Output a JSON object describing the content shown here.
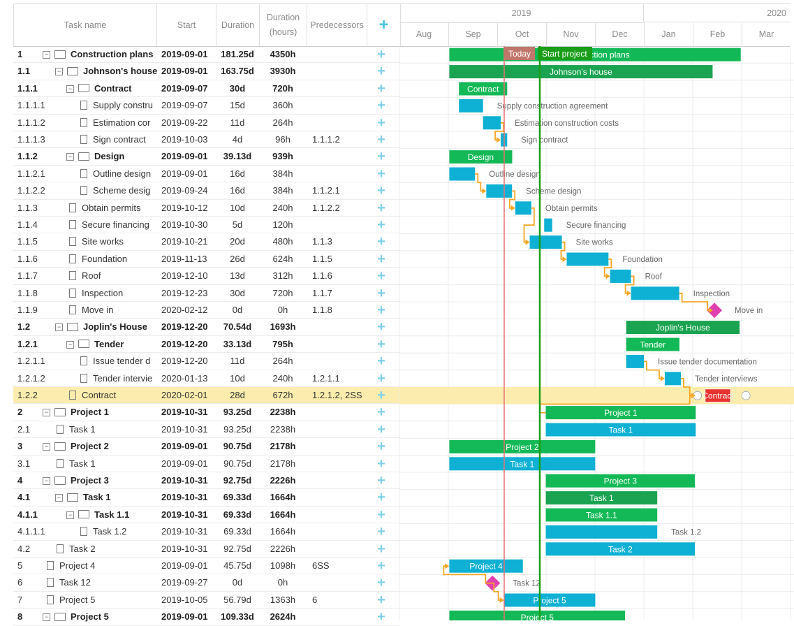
{
  "columns": {
    "task_name": "Task name",
    "start": "Start",
    "duration": "Duration",
    "duration_hours_1": "Duration",
    "duration_hours_2": "(hours)",
    "predecessors": "Predecessors",
    "add": "+"
  },
  "timeline": {
    "years": [
      {
        "label": "2019"
      },
      {
        "label": "2020"
      }
    ],
    "months": [
      "Aug",
      "Sep",
      "Oct",
      "Nov",
      "Dec",
      "Jan",
      "Feb",
      "Mar"
    ],
    "today_label": "Today",
    "start_label": "Start project"
  },
  "tasks": [
    {
      "wbs": "1",
      "name": "Construction plans",
      "start": "2019-09-01",
      "duration": "181.25d",
      "hours": "4350h",
      "pred": "",
      "bold": true,
      "level": 0,
      "icon": "folder",
      "bar": "Construction plans"
    },
    {
      "wbs": "1.1",
      "name": "Johnson's house",
      "start": "2019-09-01",
      "duration": "163.75d",
      "hours": "3930h",
      "pred": "",
      "bold": true,
      "level": 1,
      "icon": "folder",
      "bar": "Johnson's house"
    },
    {
      "wbs": "1.1.1",
      "name": "Contract",
      "start": "2019-09-07",
      "duration": "30d",
      "hours": "720h",
      "pred": "",
      "bold": true,
      "level": 2,
      "icon": "folder",
      "bar": "Contract"
    },
    {
      "wbs": "1.1.1.1",
      "name": "Supply constru",
      "start": "2019-09-07",
      "duration": "15d",
      "hours": "360h",
      "pred": "",
      "bold": false,
      "level": 3,
      "icon": "doc",
      "bar": "Supply construction agreement"
    },
    {
      "wbs": "1.1.1.2",
      "name": "Estimation cor",
      "start": "2019-09-22",
      "duration": "11d",
      "hours": "264h",
      "pred": "",
      "bold": false,
      "level": 3,
      "icon": "doc",
      "bar": "Estimation construction costs"
    },
    {
      "wbs": "1.1.1.3",
      "name": "Sign contract",
      "start": "2019-10-03",
      "duration": "4d",
      "hours": "96h",
      "pred": "1.1.1.2",
      "bold": false,
      "level": 3,
      "icon": "doc",
      "bar": "Sign contract"
    },
    {
      "wbs": "1.1.2",
      "name": "Design",
      "start": "2019-09-01",
      "duration": "39.13d",
      "hours": "939h",
      "pred": "",
      "bold": true,
      "level": 2,
      "icon": "folder",
      "bar": "Design"
    },
    {
      "wbs": "1.1.2.1",
      "name": "Outline design",
      "start": "2019-09-01",
      "duration": "16d",
      "hours": "384h",
      "pred": "",
      "bold": false,
      "level": 3,
      "icon": "doc",
      "bar": "Outline design"
    },
    {
      "wbs": "1.1.2.2",
      "name": "Scheme desig",
      "start": "2019-09-24",
      "duration": "16d",
      "hours": "384h",
      "pred": "1.1.2.1",
      "bold": false,
      "level": 3,
      "icon": "doc",
      "bar": "Scheme design"
    },
    {
      "wbs": "1.1.3",
      "name": "Obtain permits",
      "start": "2019-10-12",
      "duration": "10d",
      "hours": "240h",
      "pred": "1.1.2.2",
      "bold": false,
      "level": 2,
      "icon": "doc",
      "bar": "Obtain permits"
    },
    {
      "wbs": "1.1.4",
      "name": "Secure financing",
      "start": "2019-10-30",
      "duration": "5d",
      "hours": "120h",
      "pred": "",
      "bold": false,
      "level": 2,
      "icon": "doc",
      "bar": "Secure financing"
    },
    {
      "wbs": "1.1.5",
      "name": "Site works",
      "start": "2019-10-21",
      "duration": "20d",
      "hours": "480h",
      "pred": "1.1.3",
      "bold": false,
      "level": 2,
      "icon": "doc",
      "bar": "Site works"
    },
    {
      "wbs": "1.1.6",
      "name": "Foundation",
      "start": "2019-11-13",
      "duration": "26d",
      "hours": "624h",
      "pred": "1.1.5",
      "bold": false,
      "level": 2,
      "icon": "doc",
      "bar": "Foundation"
    },
    {
      "wbs": "1.1.7",
      "name": "Roof",
      "start": "2019-12-10",
      "duration": "13d",
      "hours": "312h",
      "pred": "1.1.6",
      "bold": false,
      "level": 2,
      "icon": "doc",
      "bar": "Roof"
    },
    {
      "wbs": "1.1.8",
      "name": "Inspection",
      "start": "2019-12-23",
      "duration": "30d",
      "hours": "720h",
      "pred": "1.1.7",
      "bold": false,
      "level": 2,
      "icon": "doc",
      "bar": "Inspection"
    },
    {
      "wbs": "1.1.9",
      "name": "Move in",
      "start": "2020-02-12",
      "duration": "0d",
      "hours": "0h",
      "pred": "1.1.8",
      "bold": false,
      "level": 2,
      "icon": "doc",
      "bar": "Move in"
    },
    {
      "wbs": "1.2",
      "name": "Joplin's House",
      "start": "2019-12-20",
      "duration": "70.54d",
      "hours": "1693h",
      "pred": "",
      "bold": true,
      "level": 1,
      "icon": "folder",
      "bar": "Joplin's House"
    },
    {
      "wbs": "1.2.1",
      "name": "Tender",
      "start": "2019-12-20",
      "duration": "33.13d",
      "hours": "795h",
      "pred": "",
      "bold": true,
      "level": 2,
      "icon": "folder",
      "bar": "Tender"
    },
    {
      "wbs": "1.2.1.1",
      "name": "Issue tender d",
      "start": "2019-12-20",
      "duration": "11d",
      "hours": "264h",
      "pred": "",
      "bold": false,
      "level": 3,
      "icon": "doc",
      "bar": "Issue tender documentation"
    },
    {
      "wbs": "1.2.1.2",
      "name": "Tender intervie",
      "start": "2020-01-13",
      "duration": "10d",
      "hours": "240h",
      "pred": "1.2.1.1",
      "bold": false,
      "level": 3,
      "icon": "doc",
      "bar": "Tender interviews"
    },
    {
      "wbs": "1.2.2",
      "name": "Contract",
      "start": "2020-02-01",
      "duration": "28d",
      "hours": "672h",
      "pred": "1.2.1.2, 2SS",
      "bold": false,
      "level": 2,
      "icon": "doc",
      "bar": "Contract",
      "selected": true
    },
    {
      "wbs": "2",
      "name": "Project 1",
      "start": "2019-10-31",
      "duration": "93.25d",
      "hours": "2238h",
      "pred": "",
      "bold": true,
      "level": 0,
      "icon": "folder",
      "bar": "Project 1"
    },
    {
      "wbs": "2.1",
      "name": "Task 1",
      "start": "2019-10-31",
      "duration": "93.25d",
      "hours": "2238h",
      "pred": "",
      "bold": false,
      "level": 1,
      "icon": "doc",
      "bar": "Task 1"
    },
    {
      "wbs": "3",
      "name": "Project 2",
      "start": "2019-09-01",
      "duration": "90.75d",
      "hours": "2178h",
      "pred": "",
      "bold": true,
      "level": 0,
      "icon": "folder",
      "bar": "Project 2"
    },
    {
      "wbs": "3.1",
      "name": "Task 1",
      "start": "2019-09-01",
      "duration": "90.75d",
      "hours": "2178h",
      "pred": "",
      "bold": false,
      "level": 1,
      "icon": "doc",
      "bar": "Task 1"
    },
    {
      "wbs": "4",
      "name": "Project 3",
      "start": "2019-10-31",
      "duration": "92.75d",
      "hours": "2226h",
      "pred": "",
      "bold": true,
      "level": 0,
      "icon": "folder",
      "bar": "Project 3"
    },
    {
      "wbs": "4.1",
      "name": "Task 1",
      "start": "2019-10-31",
      "duration": "69.33d",
      "hours": "1664h",
      "pred": "",
      "bold": true,
      "level": 1,
      "icon": "folder",
      "bar": "Task 1"
    },
    {
      "wbs": "4.1.1",
      "name": "Task 1.1",
      "start": "2019-10-31",
      "duration": "69.33d",
      "hours": "1664h",
      "pred": "",
      "bold": true,
      "level": 2,
      "icon": "folder",
      "bar": "Task 1.1"
    },
    {
      "wbs": "4.1.1.1",
      "name": "Task 1.2",
      "start": "2019-10-31",
      "duration": "69.33d",
      "hours": "1664h",
      "pred": "",
      "bold": false,
      "level": 3,
      "icon": "doc",
      "bar": "Task 1.2"
    },
    {
      "wbs": "4.2",
      "name": "Task 2",
      "start": "2019-10-31",
      "duration": "92.75d",
      "hours": "2226h",
      "pred": "",
      "bold": false,
      "level": 1,
      "icon": "doc",
      "bar": "Task 2"
    },
    {
      "wbs": "5",
      "name": "Project 4",
      "start": "2019-09-01",
      "duration": "45.75d",
      "hours": "1098h",
      "pred": "6SS",
      "bold": false,
      "level": 0,
      "icon": "doc",
      "bar": "Project 4"
    },
    {
      "wbs": "6",
      "name": "Task 12",
      "start": "2019-09-27",
      "duration": "0d",
      "hours": "0h",
      "pred": "",
      "bold": false,
      "level": 0,
      "icon": "doc",
      "bar": "Task 12"
    },
    {
      "wbs": "7",
      "name": "Project 5",
      "start": "2019-10-05",
      "duration": "56.79d",
      "hours": "1363h",
      "pred": "6",
      "bold": false,
      "level": 0,
      "icon": "doc",
      "bar": "Project 5"
    },
    {
      "wbs": "8",
      "name": "Project 5",
      "start": "2019-09-01",
      "duration": "109.33d",
      "hours": "2624h",
      "pred": "",
      "bold": true,
      "level": 0,
      "icon": "folder",
      "bar": "Project 5"
    }
  ],
  "colors": {
    "summary": "#1aa350",
    "project": "#14b957",
    "task": "#0eb0d4",
    "task_dark": "#0e94b8",
    "milestone": "#e040b0",
    "link": "#f5a623",
    "today": "#e87070",
    "start_line": "#1a9e1a",
    "selected_task": "#e8322e"
  }
}
